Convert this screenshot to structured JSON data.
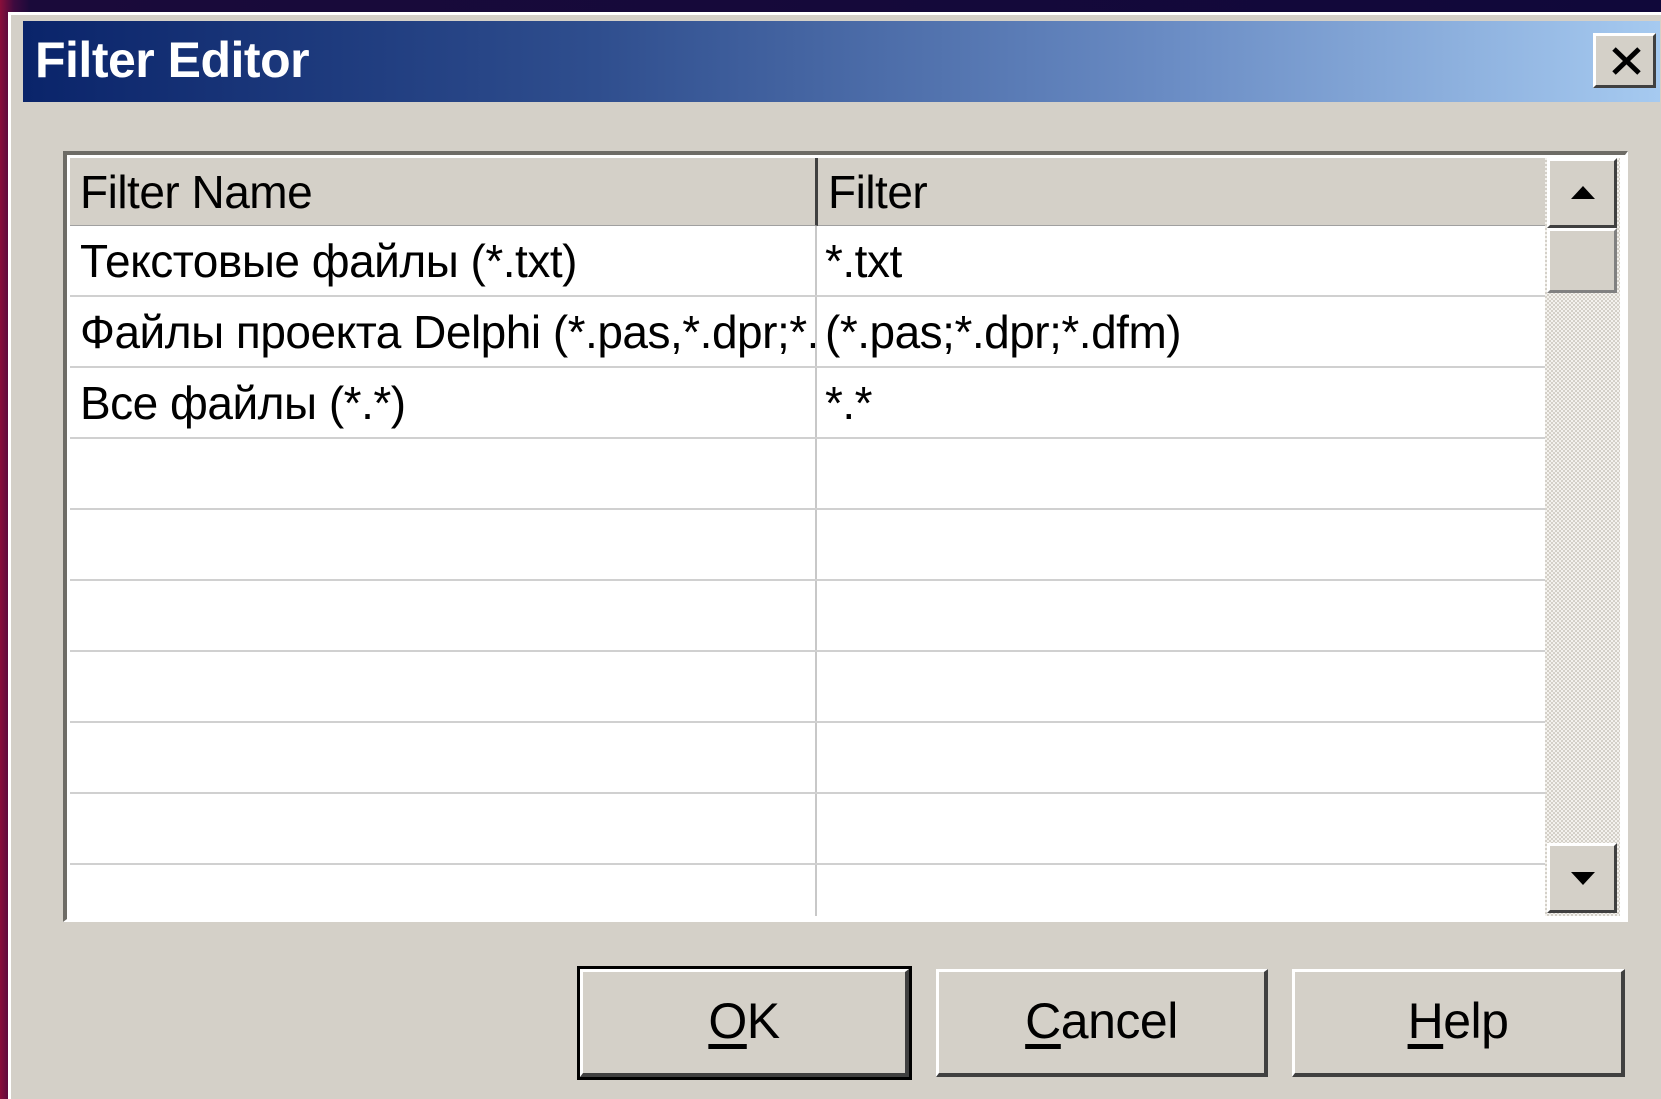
{
  "window": {
    "title": "Filter Editor"
  },
  "grid": {
    "columns": [
      "Filter Name",
      "Filter"
    ],
    "rows": [
      [
        "Текстовые файлы (*.txt)",
        "*.txt"
      ],
      [
        "Файлы проекта Delphi (*.pas,*.dpr;*.dfm)",
        "(*.pas;*.dpr;*.dfm)"
      ],
      [
        "Все файлы (*.*)",
        "*.*"
      ],
      [
        "",
        ""
      ],
      [
        "",
        ""
      ],
      [
        "",
        ""
      ],
      [
        "",
        ""
      ],
      [
        "",
        ""
      ],
      [
        "",
        ""
      ],
      [
        "",
        ""
      ]
    ]
  },
  "buttons": {
    "ok": {
      "accel": "O",
      "rest": "K"
    },
    "cancel": {
      "accel": "C",
      "rest": "ancel"
    },
    "help": {
      "accel": "H",
      "rest": "elp"
    }
  },
  "icons": {
    "close": "close-icon",
    "scroll_up": "arrow-up-icon",
    "scroll_down": "arrow-down-icon"
  },
  "colors": {
    "face": "#d4d0c8",
    "title_start": "#0a246a",
    "title_end": "#a6caf0"
  }
}
